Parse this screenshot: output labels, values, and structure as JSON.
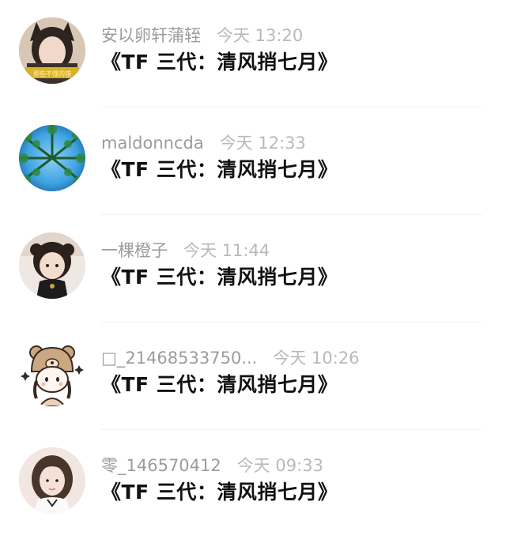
{
  "comments": [
    {
      "username": "安以卵轩蒲轾",
      "time": "今天 13:20",
      "text": "《TF 三代：清风捎七月》",
      "avatar_icon": "girl-cat-ears-avatar",
      "avatar_caption": "那些不懂的错"
    },
    {
      "username": "maldonncda",
      "time": "今天 12:33",
      "text": "《TF 三代：清风捎七月》",
      "avatar_icon": "forest-sky-avatar"
    },
    {
      "username": "一棵橙子",
      "time": "今天 11:44",
      "text": "《TF 三代：清风捎七月》",
      "avatar_icon": "child-photo-avatar"
    },
    {
      "username": "□_21468533750...",
      "time": "今天 10:26",
      "text": "《TF 三代：清风捎七月》",
      "avatar_icon": "cartoon-bear-hat-avatar"
    },
    {
      "username": "零_146570412",
      "time": "今天 09:33",
      "text": "《TF 三代：清风捎七月》",
      "avatar_icon": "girl-portrait-avatar"
    }
  ]
}
